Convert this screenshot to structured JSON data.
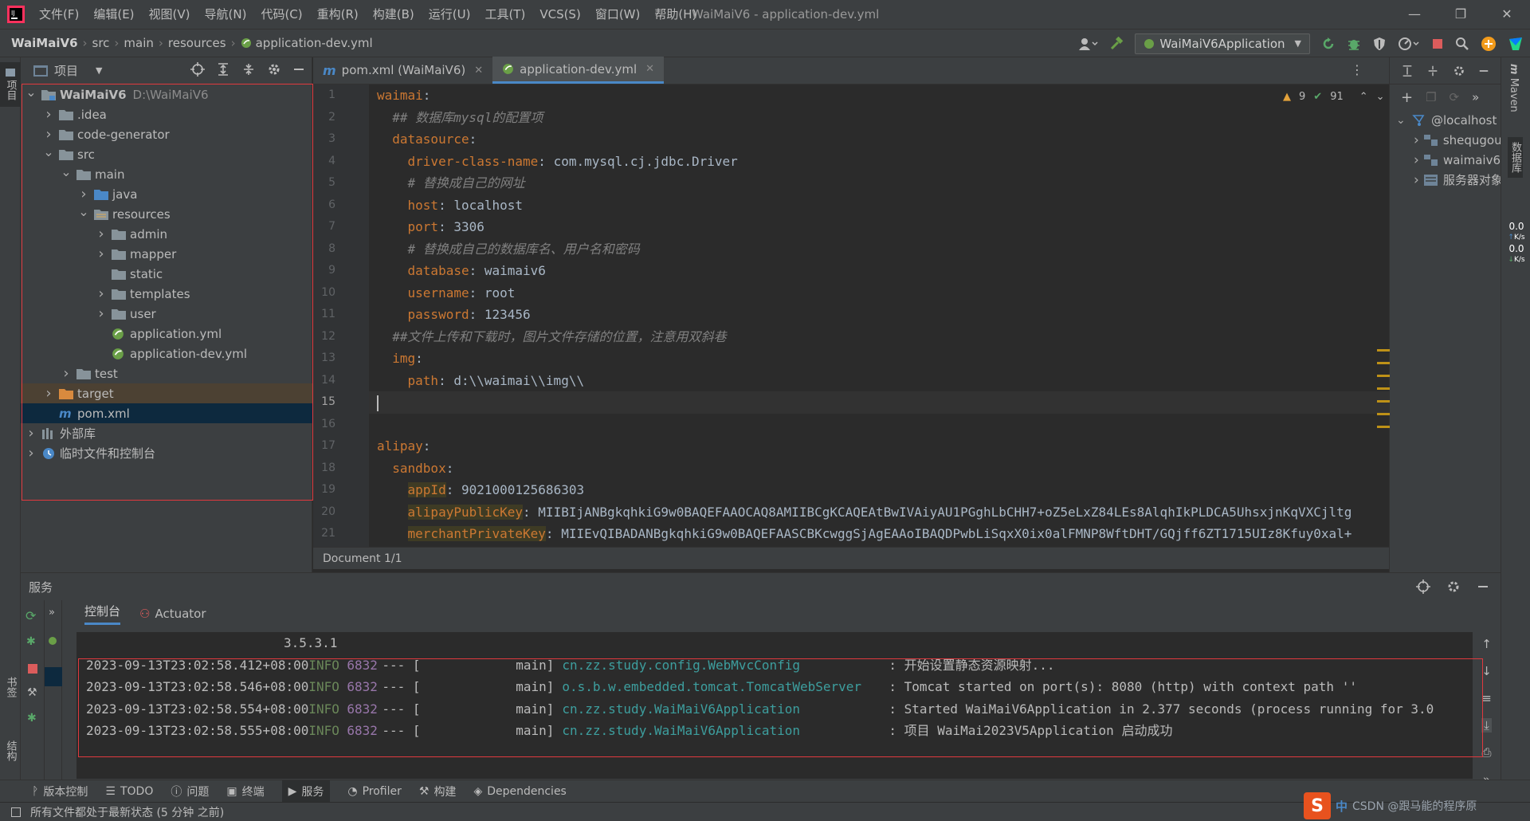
{
  "window": {
    "title": "WaiMaiV6 - application-dev.yml",
    "menu": [
      "文件(F)",
      "编辑(E)",
      "视图(V)",
      "导航(N)",
      "代码(C)",
      "重构(R)",
      "构建(B)",
      "运行(U)",
      "工具(T)",
      "VCS(S)",
      "窗口(W)",
      "帮助(H)"
    ],
    "controls": [
      "—",
      "❐",
      "✕"
    ]
  },
  "breadcrumb": [
    "WaiMaiV6",
    "src",
    "main",
    "resources",
    "application-dev.yml"
  ],
  "run_config": "WaiMaiV6Application",
  "project_panel": {
    "title": "项目",
    "tree": [
      {
        "label": "WaiMaiV6",
        "path": "D:\\WaiMaiV6",
        "depth": 0,
        "arrow": "down",
        "icon": "module-folder-icon"
      },
      {
        "label": ".idea",
        "depth": 1,
        "arrow": "right",
        "icon": "folder-icon"
      },
      {
        "label": "code-generator",
        "depth": 1,
        "arrow": "right",
        "icon": "folder-icon"
      },
      {
        "label": "src",
        "depth": 1,
        "arrow": "down",
        "icon": "folder-icon"
      },
      {
        "label": "main",
        "depth": 2,
        "arrow": "down",
        "icon": "folder-icon"
      },
      {
        "label": "java",
        "depth": 3,
        "arrow": "right",
        "icon": "source-folder-icon"
      },
      {
        "label": "resources",
        "depth": 3,
        "arrow": "down",
        "icon": "resources-folder-icon"
      },
      {
        "label": "admin",
        "depth": 4,
        "arrow": "right",
        "icon": "folder-icon"
      },
      {
        "label": "mapper",
        "depth": 4,
        "arrow": "right",
        "icon": "folder-icon"
      },
      {
        "label": "static",
        "depth": 4,
        "arrow": "",
        "icon": "folder-icon"
      },
      {
        "label": "templates",
        "depth": 4,
        "arrow": "right",
        "icon": "folder-icon"
      },
      {
        "label": "user",
        "depth": 4,
        "arrow": "right",
        "icon": "folder-icon"
      },
      {
        "label": "application.yml",
        "depth": 4,
        "arrow": "",
        "icon": "spring-yml-icon"
      },
      {
        "label": "application-dev.yml",
        "depth": 4,
        "arrow": "",
        "icon": "spring-yml-icon"
      },
      {
        "label": "test",
        "depth": 2,
        "arrow": "right",
        "icon": "folder-icon"
      },
      {
        "label": "target",
        "depth": 1,
        "arrow": "right",
        "icon": "excluded-folder-icon",
        "state": "brown"
      },
      {
        "label": "pom.xml",
        "depth": 1,
        "arrow": "",
        "icon": "maven-icon",
        "state": "selected"
      },
      {
        "label": "外部库",
        "depth": 0,
        "arrow": "right",
        "icon": "library-icon"
      },
      {
        "label": "临时文件和控制台",
        "depth": 0,
        "arrow": "right",
        "icon": "scratch-icon"
      }
    ]
  },
  "editor": {
    "tabs": [
      {
        "label": "pom.xml (WaiMaiV6)",
        "icon": "maven-icon",
        "active": false
      },
      {
        "label": "application-dev.yml",
        "icon": "spring-yml-icon",
        "active": true
      }
    ],
    "warnings": "9",
    "checks": "91",
    "current_line": 15,
    "line_numbers": [
      "1",
      "2",
      "3",
      "4",
      "5",
      "6",
      "7",
      "8",
      "9",
      "10",
      "11",
      "12",
      "13",
      "14",
      "15",
      "16",
      "17",
      "18",
      "19",
      "20",
      "21"
    ],
    "lines": [
      [
        {
          "t": "waimai",
          "c": "k"
        },
        {
          "t": ":",
          "c": "v"
        }
      ],
      [
        {
          "t": "  ## 数据库mysql的配置项",
          "c": "cm"
        }
      ],
      [
        {
          "t": "  datasource",
          "c": "k"
        },
        {
          "t": ":",
          "c": "v"
        }
      ],
      [
        {
          "t": "    driver-class-name",
          "c": "k"
        },
        {
          "t": ": com.mysql.cj.jdbc.Driver",
          "c": "v"
        }
      ],
      [
        {
          "t": "    # 替换成自己的网址",
          "c": "cm"
        }
      ],
      [
        {
          "t": "    host",
          "c": "k"
        },
        {
          "t": ": localhost",
          "c": "v"
        }
      ],
      [
        {
          "t": "    port",
          "c": "k"
        },
        {
          "t": ": 3306",
          "c": "v"
        }
      ],
      [
        {
          "t": "    # 替换成自己的数据库名、用户名和密码",
          "c": "cm"
        }
      ],
      [
        {
          "t": "    database",
          "c": "k"
        },
        {
          "t": ": waimaiv6",
          "c": "v"
        }
      ],
      [
        {
          "t": "    username",
          "c": "k"
        },
        {
          "t": ": root",
          "c": "v"
        }
      ],
      [
        {
          "t": "    password",
          "c": "k"
        },
        {
          "t": ": 123456",
          "c": "v"
        }
      ],
      [
        {
          "t": "  ##文件上传和下载时，图片文件存储的位置，注意用双斜巷",
          "c": "cm"
        }
      ],
      [
        {
          "t": "  img",
          "c": "k"
        },
        {
          "t": ":",
          "c": "v"
        }
      ],
      [
        {
          "t": "    path",
          "c": "k"
        },
        {
          "t": ": d:\\\\waimai\\\\img\\\\",
          "c": "v"
        }
      ],
      [
        {
          "t": "",
          "c": "v"
        }
      ],
      [
        {
          "t": "",
          "c": "v"
        }
      ],
      [
        {
          "t": "alipay",
          "c": "k"
        },
        {
          "t": ":",
          "c": "v"
        }
      ],
      [
        {
          "t": "  sandbox",
          "c": "k"
        },
        {
          "t": ":",
          "c": "v"
        }
      ],
      [
        {
          "t": "    ",
          "c": "v"
        },
        {
          "t": "appId",
          "c": "k hl"
        },
        {
          "t": ": 9021000125686303",
          "c": "v"
        }
      ],
      [
        {
          "t": "    ",
          "c": "v"
        },
        {
          "t": "alipayPublicKey",
          "c": "k hl"
        },
        {
          "t": ": MIIBIjANBgkqhkiG9w0BAQEFAAOCAQ8AMIIBCgKCAQEAtBwIVAiyAU1PGghLbCHH7+oZ5eLxZ84LEs8AlqhIkPLDCA5UhsxjnKqVXCjltg",
          "c": "v"
        }
      ],
      [
        {
          "t": "    ",
          "c": "v"
        },
        {
          "t": "merchantPrivateKey",
          "c": "k hl"
        },
        {
          "t": ": MIIEvQIBADANBgkqhkiG9w0BAQEFAASCBKcwggSjAgEAAoIBAQDPwbLiSqxX0ix0alFMNP8WftDHT/GQjff6ZT1715UIz8Kfuy0xal+",
          "c": "v"
        }
      ]
    ],
    "doc_status": "Document 1/1"
  },
  "database_panel": {
    "items": [
      {
        "label": "@localhost",
        "depth": 0,
        "arrow": "down",
        "icon": "datasource-icon"
      },
      {
        "label": "shequgou",
        "depth": 1,
        "arrow": "right",
        "icon": "schema-icon"
      },
      {
        "label": "waimaiv6",
        "depth": 1,
        "arrow": "right",
        "icon": "schema-icon"
      },
      {
        "label": "服务器对象",
        "depth": 1,
        "arrow": "right",
        "icon": "server-objects-icon"
      }
    ],
    "net_up": "0.0",
    "net_up_unit": "K/s",
    "net_down": "0.0",
    "net_down_unit": "K/s"
  },
  "right_strip": {
    "maven": "Maven",
    "database": "数据库"
  },
  "left_strip": {
    "project": "项目",
    "bookmarks": "书签",
    "structure": "结构"
  },
  "services": {
    "title": "服务",
    "tabs": [
      "控制台",
      "Actuator"
    ],
    "version_line": "3.5.3.1",
    "log": [
      {
        "ts": "2023-09-13T23:02:58.412+08:00",
        "level": "INFO",
        "pid": "6832",
        "sep": "--- [",
        "thread": "main]",
        "cls": "cn.zz.study.config.WebMvcConfig",
        "msg": ": 开始设置静态资源映射..."
      },
      {
        "ts": "2023-09-13T23:02:58.546+08:00",
        "level": "INFO",
        "pid": "6832",
        "sep": "--- [",
        "thread": "main]",
        "cls": "o.s.b.w.embedded.tomcat.TomcatWebServer",
        "msg": ": Tomcat started on port(s): 8080 (http) with context path ''"
      },
      {
        "ts": "2023-09-13T23:02:58.554+08:00",
        "level": "INFO",
        "pid": "6832",
        "sep": "--- [",
        "thread": "main]",
        "cls": "cn.zz.study.WaiMaiV6Application",
        "msg": ": Started WaiMaiV6Application in 2.377 seconds (process running for 3.0"
      },
      {
        "ts": "2023-09-13T23:02:58.555+08:00",
        "level": "INFO",
        "pid": "6832",
        "sep": "--- [",
        "thread": "main]",
        "cls": "cn.zz.study.WaiMaiV6Application",
        "msg": ": 项目 WaiMai2023V5Application 启动成功"
      }
    ]
  },
  "bottom_tools": [
    "版本控制",
    "TODO",
    "问题",
    "终端",
    "服务",
    "Profiler",
    "构建",
    "Dependencies"
  ],
  "active_bottom_tool": "服务",
  "status_text": "所有文件都处于最新状态 (5 分钟 之前)",
  "ime": {
    "label": "中",
    "watermark": "CSDN @跟马能的程序原"
  },
  "colors": {
    "accent": "#4a88c7",
    "keyword": "#cc7832",
    "comment": "#808080",
    "red_box": "#e0393e",
    "console_class": "#3d9e9e"
  }
}
